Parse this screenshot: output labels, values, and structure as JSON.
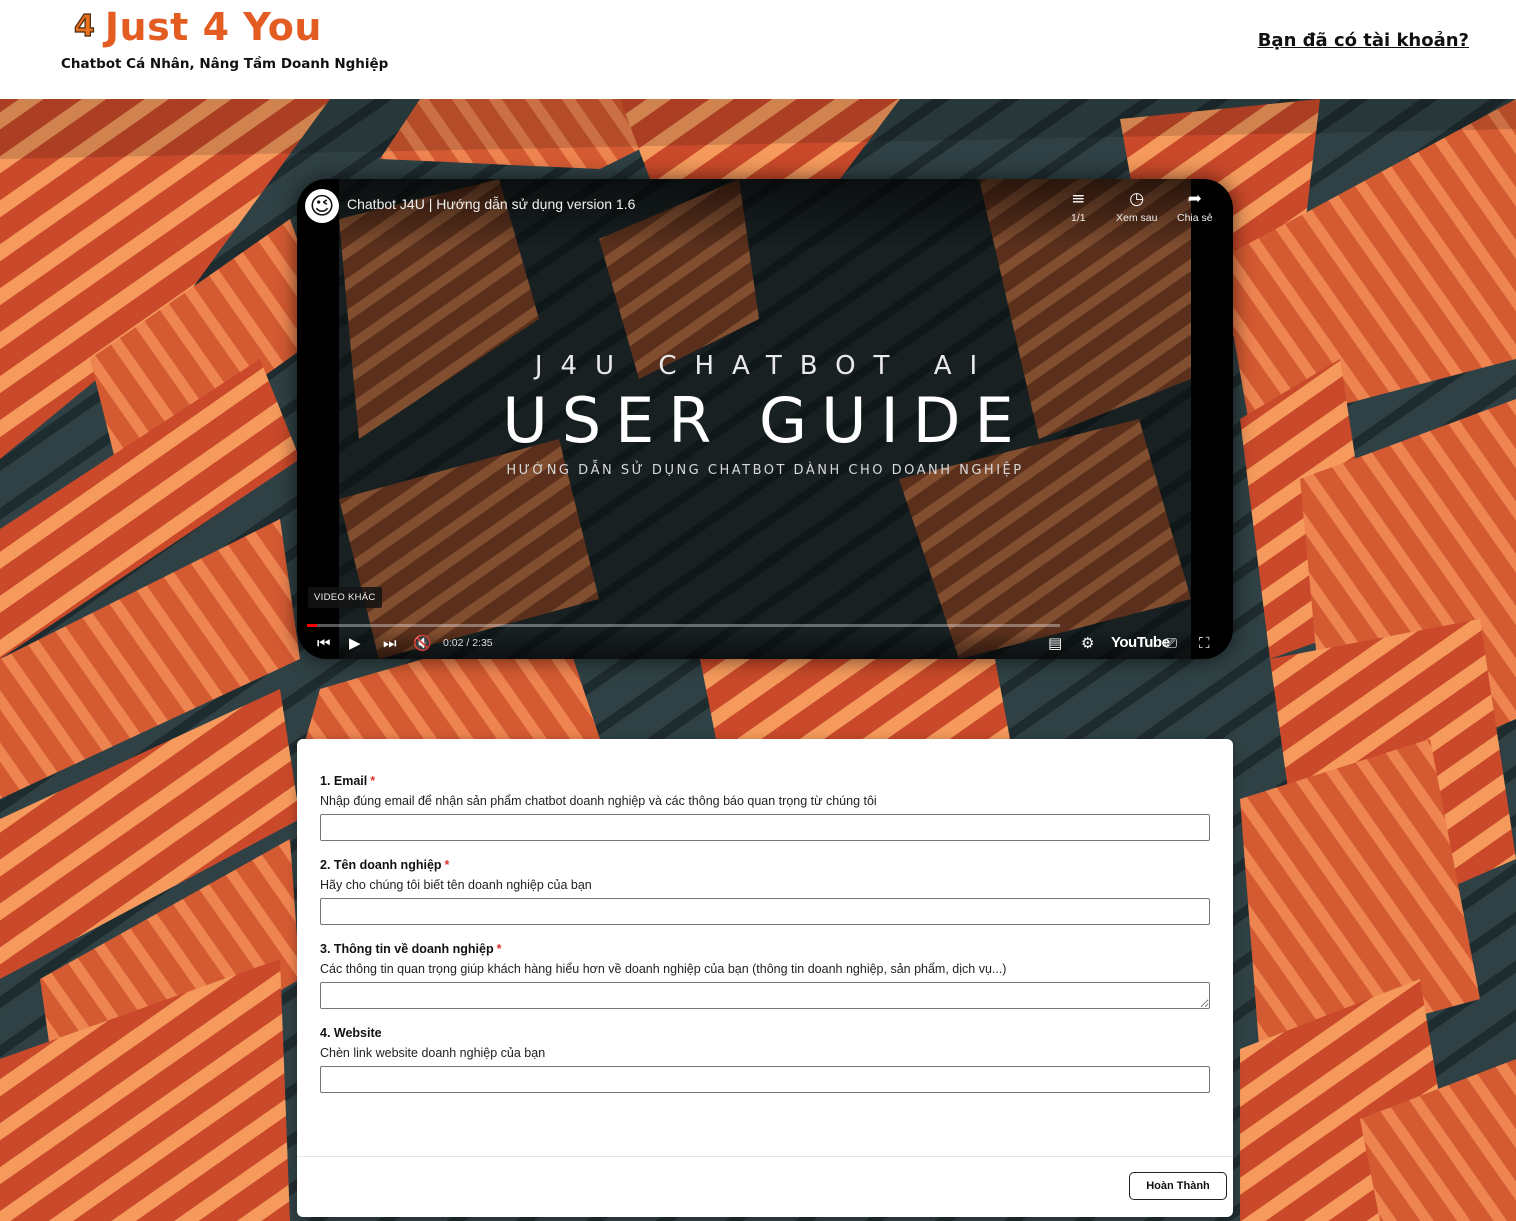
{
  "brand": {
    "logo_mark": "4",
    "name": "Just 4 You",
    "tagline": "Chatbot Cá Nhân, Nâng Tầm Doanh Nghiệp",
    "color": "#e35c22"
  },
  "header": {
    "login_link": "Bạn đã có tài khoản?"
  },
  "video": {
    "channel_icon": "wink-face-icon",
    "title": "Chatbot J4U | Hướng dẫn sử dụng version 1.6",
    "playlist": {
      "icon": "playlist-icon",
      "label": "1/1"
    },
    "watch_later": {
      "icon": "clock-icon",
      "label": "Xem sau"
    },
    "share": {
      "icon": "share-arrow-icon",
      "label": "Chia sẻ"
    },
    "thumbnail_kicker": "J4U CHATBOT AI",
    "thumbnail_title": "USER GUIDE",
    "thumbnail_subtitle": "HƯỚNG DẪN SỬ DỤNG CHATBOT DÀNH CHO DOANH NGHIỆP",
    "more_videos": "VIDEO KHÁC",
    "time": "0:02 / 2:35",
    "progress_fraction": 0.013,
    "youtube_label": "YouTube",
    "progress_color": "#ff0000"
  },
  "form": {
    "fields": [
      {
        "label": "1. Email",
        "required": "*",
        "help": "Nhập đúng email để nhận sản phẩm chatbot doanh nghiệp và các thông báo quan trọng từ chúng tôi",
        "value": ""
      },
      {
        "label": "2. Tên doanh nghiệp",
        "required": "*",
        "help": "Hãy cho chúng tôi biết tên doanh nghiệp của bạn",
        "value": ""
      },
      {
        "label": "3. Thông tin về doanh nghiệp",
        "required": "*",
        "help": "Các thông tin quan trọng giúp khách hàng hiểu hơn về doanh nghiệp của bạn (thông tin doanh nghiệp, sản phẩm, dịch vụ...)",
        "value": ""
      },
      {
        "label": "4. Website",
        "required": "",
        "help": "Chèn link website doanh nghiệp của bạn",
        "value": ""
      }
    ],
    "submit_label": "Hoàn Thành"
  }
}
